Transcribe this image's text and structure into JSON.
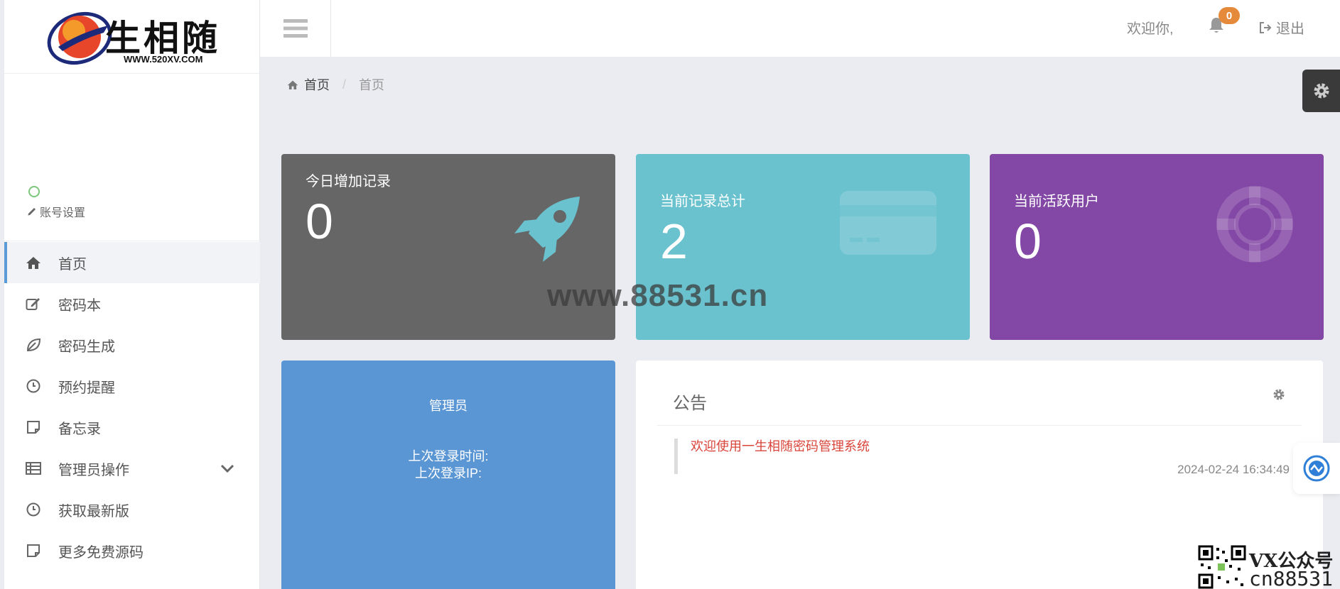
{
  "logo": {
    "brand_text": "生相随",
    "url_text": "WWW.520XV.COM"
  },
  "sidebar": {
    "account_settings": "账号设置",
    "items": [
      {
        "label": "首页",
        "icon": "home-icon",
        "active": true
      },
      {
        "label": "密码本",
        "icon": "edit-icon"
      },
      {
        "label": "密码生成",
        "icon": "leaf-icon"
      },
      {
        "label": "预约提醒",
        "icon": "clock-icon"
      },
      {
        "label": "备忘录",
        "icon": "note-icon"
      },
      {
        "label": "管理员操作",
        "icon": "table-icon",
        "expandable": true
      },
      {
        "label": "获取最新版",
        "icon": "clock-icon"
      },
      {
        "label": "更多免费源码",
        "icon": "note-icon"
      }
    ]
  },
  "header": {
    "welcome": "欢迎你,",
    "notification_count": "0",
    "logout": "退出"
  },
  "breadcrumb": {
    "home": "首页",
    "current": "首页"
  },
  "stats": {
    "today": {
      "title": "今日增加记录",
      "value": "0",
      "color": "#666666"
    },
    "total": {
      "title": "当前记录总计",
      "value": "2",
      "color": "#6ac2cf"
    },
    "active": {
      "title": "当前活跃用户",
      "value": "0",
      "color": "#8347a5"
    }
  },
  "admin": {
    "title": "管理员",
    "last_login_time": "上次登录时间:",
    "last_login_ip": "上次登录IP:"
  },
  "notice": {
    "title": "公告",
    "items": [
      {
        "text": "欢迎使用一生相随密码管理系统",
        "time": "2024-02-24 16:34:49"
      }
    ]
  },
  "watermark": "www.88531.cn",
  "qr": {
    "line1": "VX公众号",
    "line2": "cn88531"
  }
}
